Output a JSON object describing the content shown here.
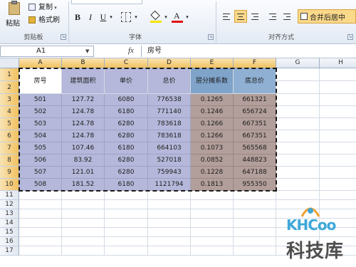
{
  "ribbon": {
    "paste_label": "粘贴",
    "copy_label": "复制",
    "format_painter_label": "格式刷",
    "clipboard_group": "剪贴板",
    "font_group": "字体",
    "alignment_group": "对齐方式",
    "merge_center_label": "合并后居中",
    "bold": "B",
    "italic": "I",
    "underline": "U"
  },
  "formula_bar": {
    "name_box": "A1",
    "fx_label": "fx",
    "formula": "房号"
  },
  "columns": [
    "A",
    "B",
    "C",
    "D",
    "E",
    "F",
    "G",
    "H"
  ],
  "rows": [
    "1",
    "2",
    "3",
    "4",
    "5",
    "6",
    "7",
    "8",
    "9",
    "10",
    "11",
    "12",
    "13",
    "14",
    "15",
    "16",
    "17"
  ],
  "table": {
    "headers": [
      "房号",
      "建筑面积",
      "单价",
      "总价",
      "层分摊系数",
      "底总价"
    ],
    "rows": [
      [
        "501",
        "127.72",
        "6080",
        "776538",
        "0.1265",
        "661321"
      ],
      [
        "502",
        "124.78",
        "6180",
        "771140",
        "0.1246",
        "656724"
      ],
      [
        "503",
        "124.78",
        "6280",
        "783618",
        "0.1266",
        "667351"
      ],
      [
        "504",
        "124.78",
        "6280",
        "783618",
        "0.1266",
        "667351"
      ],
      [
        "505",
        "107.46",
        "6180",
        "664103",
        "0.1073",
        "565568"
      ],
      [
        "506",
        "83.92",
        "6280",
        "527018",
        "0.0852",
        "448823"
      ],
      [
        "507",
        "121.01",
        "6280",
        "759943",
        "0.1228",
        "647188"
      ],
      [
        "508",
        "181.52",
        "6180",
        "1121794",
        "0.1813",
        "955350"
      ]
    ]
  },
  "watermark": {
    "logo_text": "KHCoo",
    "site_text": "科技库"
  }
}
